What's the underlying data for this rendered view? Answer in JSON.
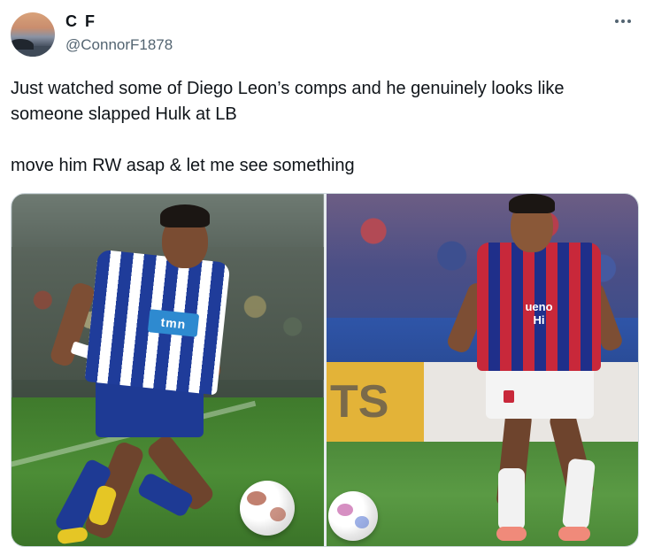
{
  "author": {
    "display_name": "C F",
    "handle": "@ConnorF1878"
  },
  "tweet": {
    "line1": "Just watched some of Diego Leon’s comps and he genuinely looks like",
    "line2": "someone slapped Hulk at LB",
    "line3": "move him RW asap & let me see something"
  },
  "media": {
    "left_sponsor": "tmn",
    "right_sponsor_line1": "ueno",
    "right_sponsor_line2": "Hi",
    "right_board_text": "TS"
  },
  "icons": {
    "more": "more-horizontal-icon"
  }
}
